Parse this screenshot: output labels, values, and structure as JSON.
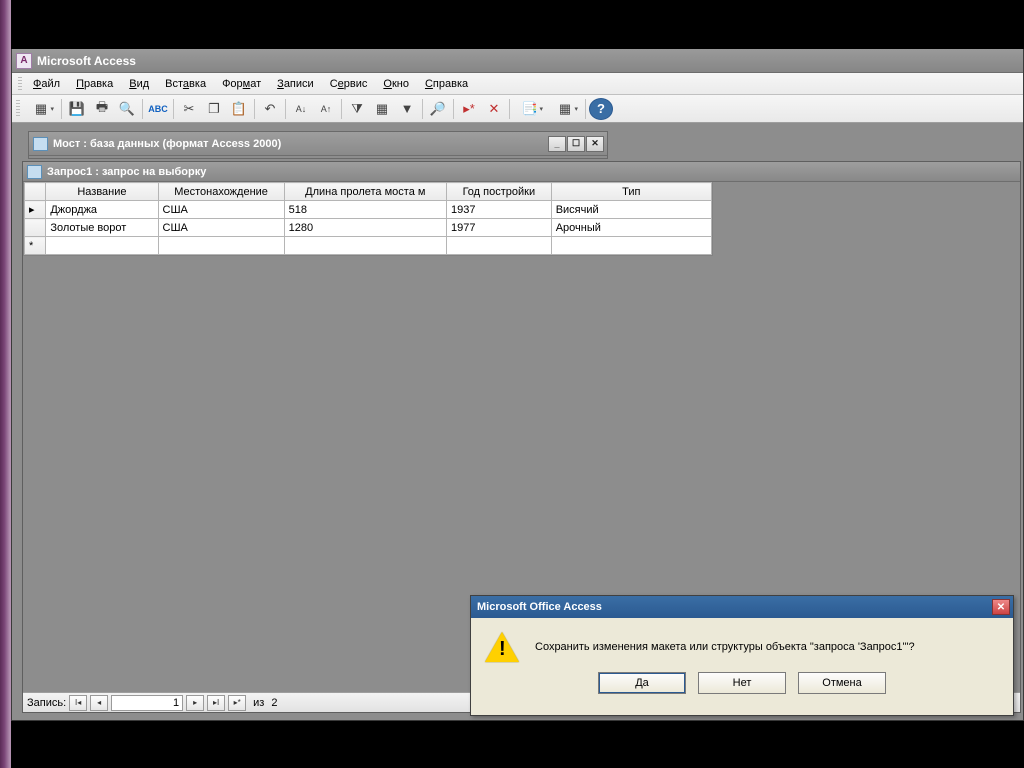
{
  "app": {
    "title": "Microsoft Access"
  },
  "menu": {
    "file": "Файл",
    "edit": "Правка",
    "view": "Вид",
    "insert": "Вставка",
    "format": "Формат",
    "records": "Записи",
    "service": "Сервис",
    "window": "Окно",
    "help": "Справка"
  },
  "db_window": {
    "title": "Мост : база данных (формат Access 2000)"
  },
  "query_window": {
    "title": "Запрос1 : запрос на выборку",
    "columns": [
      "Название",
      "Местонахождение",
      "Длина пролета моста м",
      "Год постройки",
      "Тип"
    ],
    "rows": [
      {
        "name": "Джорджа",
        "location": "США",
        "span": 518,
        "year": 1937,
        "type": "Висячий"
      },
      {
        "name": "Золотые ворот",
        "location": "США",
        "span": 1280,
        "year": 1977,
        "type": "Арочный"
      }
    ]
  },
  "record_nav": {
    "label": "Запись:",
    "current": "1",
    "of_label": "из",
    "total": "2"
  },
  "dialog": {
    "title": "Microsoft Office Access",
    "message": "Сохранить изменения макета или структуры объекта \"запроса 'Запрос1'\"?",
    "yes": "Да",
    "no": "Нет",
    "cancel": "Отмена"
  }
}
